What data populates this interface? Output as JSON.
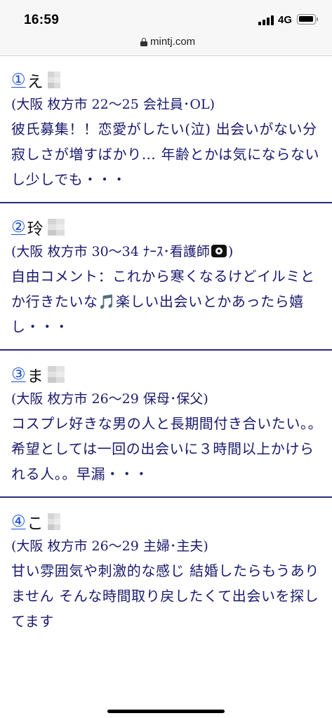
{
  "status_bar": {
    "time": "16:59",
    "network": "4G"
  },
  "browser": {
    "url": "mintj.com"
  },
  "profiles": [
    {
      "number": "①",
      "name": "え",
      "detail": "(大阪 枚方市 22〜25 会社員･OL)",
      "comment": "彼氏募集！！恋愛がしたい(泣) 出会いがない分寂しさが増すばかり… 年齢とかは気にならないし少しでも・・・"
    },
    {
      "number": "②",
      "name": "玲",
      "detail_before_icon": "(大阪 枚方市 30〜34 ﾅｰｽ･看護師",
      "detail_after_icon": ")",
      "detail_icon": "camera-icon",
      "comment": "自由コメント：これから寒くなるけどイルミとか行きたいな🎵楽しい出会いとかあったら嬉し・・・"
    },
    {
      "number": "③",
      "name": "ま",
      "detail": "(大阪 枚方市 26〜29 保母･保父)",
      "comment": "コスプレ好きな男の人と長期間付き合いたい。。希望としては一回の出会いに３時間以上かけられる人。。早漏・・・"
    },
    {
      "number": "④",
      "name": "こ",
      "detail": "(大阪 枚方市 26〜29 主婦･主夫)",
      "comment": "甘い雰囲気や刺激的な感じ 結婚したらもうありません そんな時間取り戻したくて出会いを探してます"
    }
  ]
}
